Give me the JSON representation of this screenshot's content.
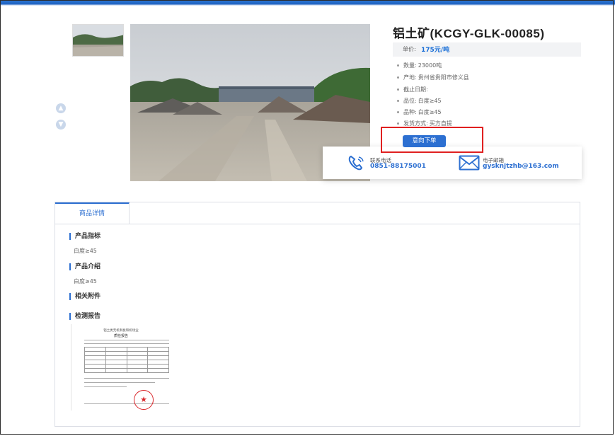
{
  "product": {
    "title": "铝土矿(KCGY-GLK-00085)",
    "price_label": "单价:",
    "price_value": "175元/吨",
    "details": [
      {
        "label": "数量:",
        "value": "23000吨"
      },
      {
        "label": "产地:",
        "value": "贵州省贵阳市修义县"
      },
      {
        "label": "截止日期:",
        "value": ""
      },
      {
        "label": "品位:",
        "value": "白度≥45"
      },
      {
        "label": "品种:",
        "value": "白度≥45"
      },
      {
        "label": "发货方式:",
        "value": "买方自提"
      }
    ],
    "order_button": "意向下单"
  },
  "contact": {
    "phone_label": "联系电话",
    "phone_value": "0851-88175001",
    "email_label": "电子邮箱",
    "email_value": "gysknjtzhb@163.com"
  },
  "detail_panel": {
    "tab": "商品详情",
    "sections": [
      {
        "title": "产品指标",
        "text": "白度≥45"
      },
      {
        "title": "产品介绍",
        "text": "白度≥45"
      },
      {
        "title": "相关附件",
        "text": ""
      },
      {
        "title": "检测报告",
        "text": ""
      }
    ]
  },
  "report": {
    "line1": "铝土类无机制板和机场业",
    "line2": "质检报告"
  },
  "icons": {
    "prev": "chevron-up-icon",
    "next": "chevron-down-icon",
    "phone": "phone-icon",
    "email": "mail-icon"
  },
  "colors": {
    "accent": "#2c6fd1",
    "highlight_box": "#e02020"
  }
}
